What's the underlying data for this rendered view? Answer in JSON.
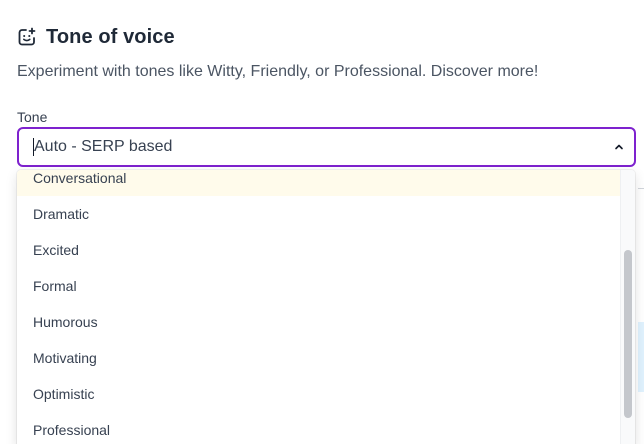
{
  "header": {
    "title": "Tone of voice",
    "icon": "smiley-sparkle-icon",
    "subtitle": "Experiment with tones like Witty, Friendly, or Professional. Discover more!"
  },
  "tone_field": {
    "label": "Tone",
    "selected_value": "Auto - SERP based",
    "focus_color": "#7e22ce"
  },
  "dropdown": {
    "options": [
      "Conversational",
      "Dramatic",
      "Excited",
      "Formal",
      "Humorous",
      "Motivating",
      "Optimistic",
      "Professional"
    ],
    "highlighted_option": "Conversational"
  }
}
